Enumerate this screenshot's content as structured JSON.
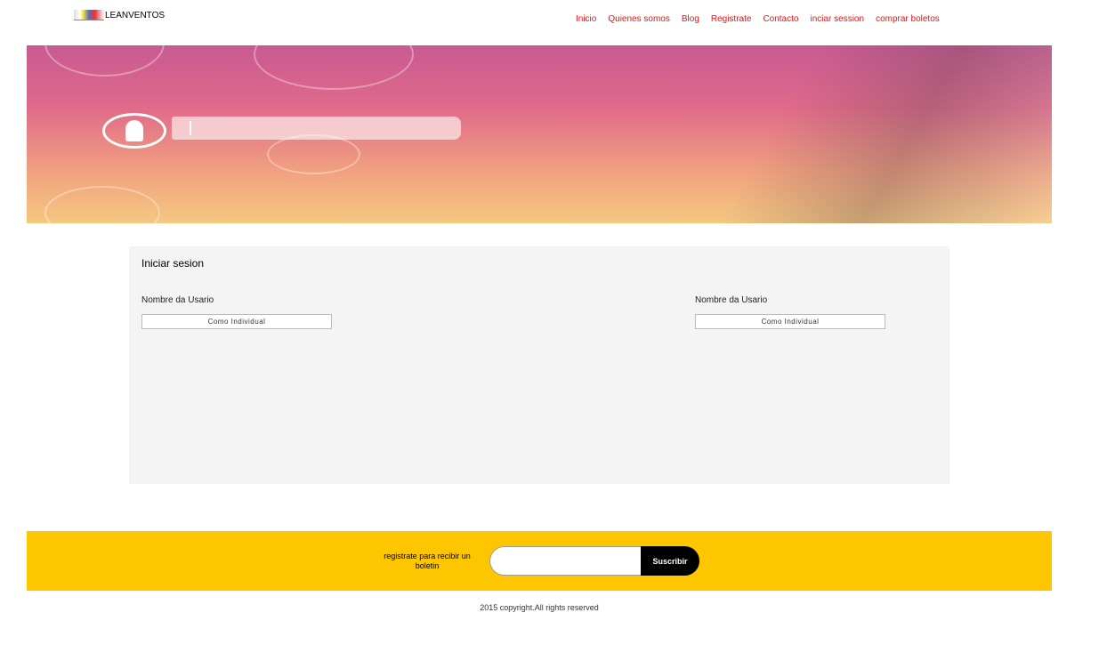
{
  "brand": "LEANVENTOS",
  "nav": [
    "Inicio",
    "Quienes somos",
    "Blog",
    "Registrate",
    "Contacto",
    "inciar session",
    "comprar boletos"
  ],
  "panel": {
    "title": "Iniciar sesion",
    "columns": [
      {
        "label": "Nombre da Usario",
        "button": "Como Individual"
      },
      {
        "label": "Nombre da Usario",
        "button": "Como Individual"
      }
    ]
  },
  "footer": {
    "newsletter_text": "registrate para recibir un boletin",
    "email_value": "",
    "subscribe": "Suscribir",
    "copyright": "2015 copyright.All rights reserved"
  },
  "colors": {
    "nav": "#f01010",
    "footer": "#fdc600"
  }
}
